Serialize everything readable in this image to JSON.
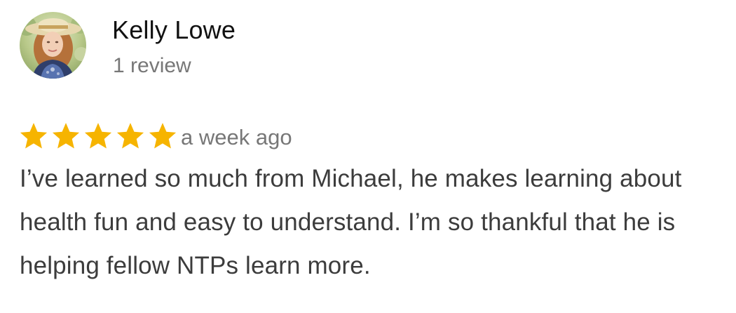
{
  "review": {
    "reviewer_name": "Kelly Lowe",
    "review_count": "1 review",
    "avatar_icon": "user-photo-avatar",
    "rating": 5,
    "rating_max": 5,
    "star_icon": "star-icon",
    "time_ago": "a week ago",
    "text": "I’ve learned so much from Michael, he makes learning about health fun and easy to understand. I’m so thankful that he is helping fellow NTPs learn more."
  },
  "colors": {
    "star": "#F6B400",
    "name": "#111111",
    "meta": "#777777",
    "body": "#3c3c3c",
    "background": "#ffffff"
  }
}
